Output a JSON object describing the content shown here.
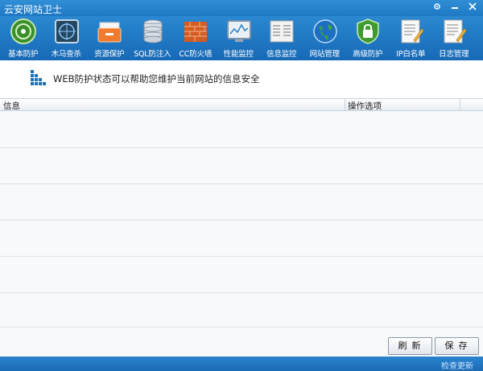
{
  "window": {
    "title": "云安网站卫士",
    "controls": [
      "gear-icon",
      "minimize-icon",
      "close-icon"
    ]
  },
  "toolbar": [
    {
      "label": "基本防护",
      "icon": "basic-protection-icon"
    },
    {
      "label": "木马查杀",
      "icon": "trojan-scan-icon"
    },
    {
      "label": "资源保护",
      "icon": "resource-protection-icon"
    },
    {
      "label": "SQL防注入",
      "icon": "sql-injection-icon"
    },
    {
      "label": "CC防火墙",
      "icon": "firewall-icon"
    },
    {
      "label": "性能监控",
      "icon": "performance-monitor-icon"
    },
    {
      "label": "信息监控",
      "icon": "info-monitor-icon"
    },
    {
      "label": "网站管理",
      "icon": "globe-icon"
    },
    {
      "label": "高级防护",
      "icon": "lock-shield-icon"
    },
    {
      "label": "IP白名单",
      "icon": "ip-whitelist-icon"
    },
    {
      "label": "日志管理",
      "icon": "log-icon"
    }
  ],
  "header": {
    "text": "WEB防护状态可以帮助您维护当前网站的信息安全"
  },
  "table": {
    "columns": [
      "信息",
      "操作选项"
    ],
    "rows": []
  },
  "buttons": {
    "refresh": "刷新",
    "save": "保存"
  },
  "status": {
    "update_link": "检查更新"
  }
}
